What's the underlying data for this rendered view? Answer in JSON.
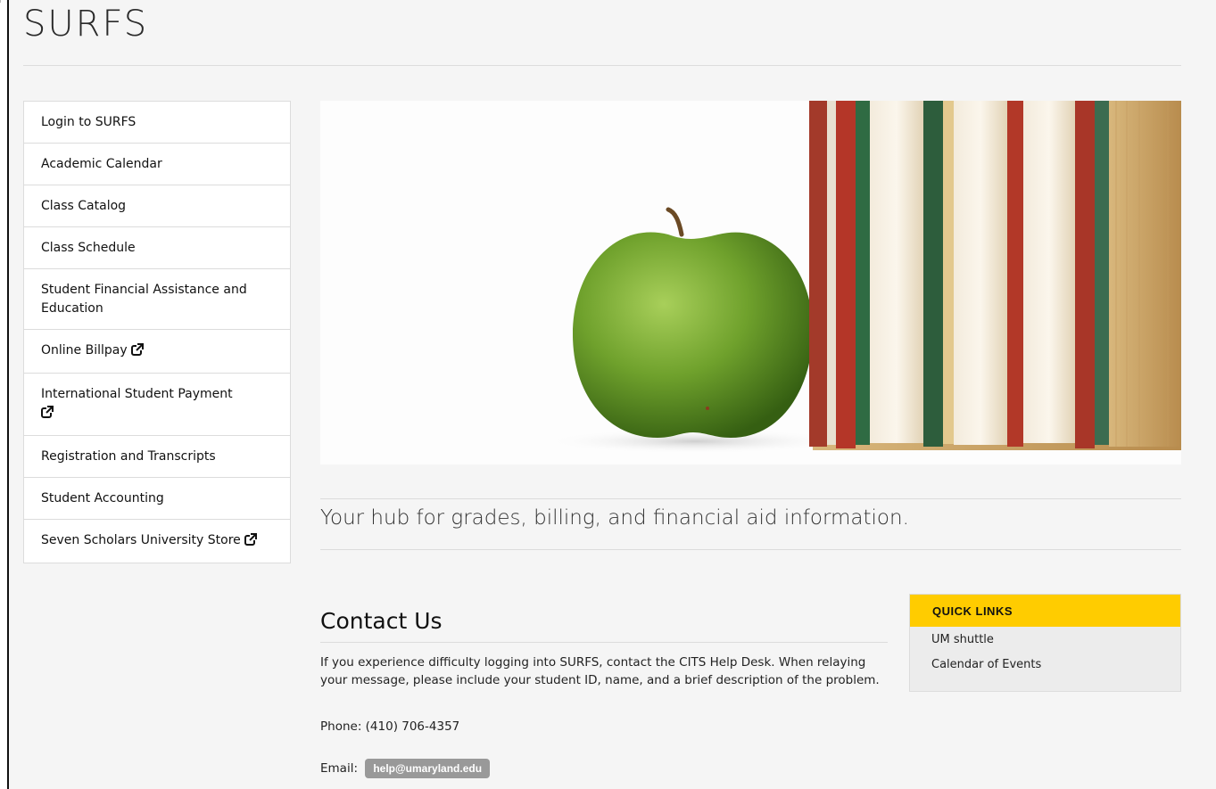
{
  "header": {
    "title": "SURFS"
  },
  "sidebar": {
    "items": [
      {
        "label": "Login to SURFS",
        "external": false
      },
      {
        "label": "Academic Calendar",
        "external": false
      },
      {
        "label": "Class Catalog",
        "external": false
      },
      {
        "label": "Class Schedule",
        "external": false
      },
      {
        "label": "Student Financial Assistance and Education",
        "external": false
      },
      {
        "label": "Online Billpay",
        "external": true
      },
      {
        "label": "International Student Payment",
        "external": true
      },
      {
        "label": "Registration and Transcripts",
        "external": false
      },
      {
        "label": "Student Accounting",
        "external": false
      },
      {
        "label": "Seven Scholars University Store",
        "external": true
      }
    ],
    "external_icon": "external-link-icon"
  },
  "hero": {
    "image": "green-apple-and-books-photo"
  },
  "tagline": "Your hub for grades, billing, and financial aid information.",
  "contact": {
    "title": "Contact Us",
    "description": "If you experience difficulty logging into SURFS, contact the CITS Help Desk. When relaying your message, please include your student ID, name, and a brief description of the problem.",
    "phone": "Phone: (410) 706-4357",
    "email_label": "Email:",
    "email": "help@umaryland.edu"
  },
  "quick_links": {
    "title": "QUICK LINKS",
    "links": [
      "UM shuttle",
      "Calendar of Events"
    ]
  },
  "colors": {
    "accent": "#ffcc00",
    "page_bg": "#f5f5f5",
    "email_badge": "#999999"
  }
}
